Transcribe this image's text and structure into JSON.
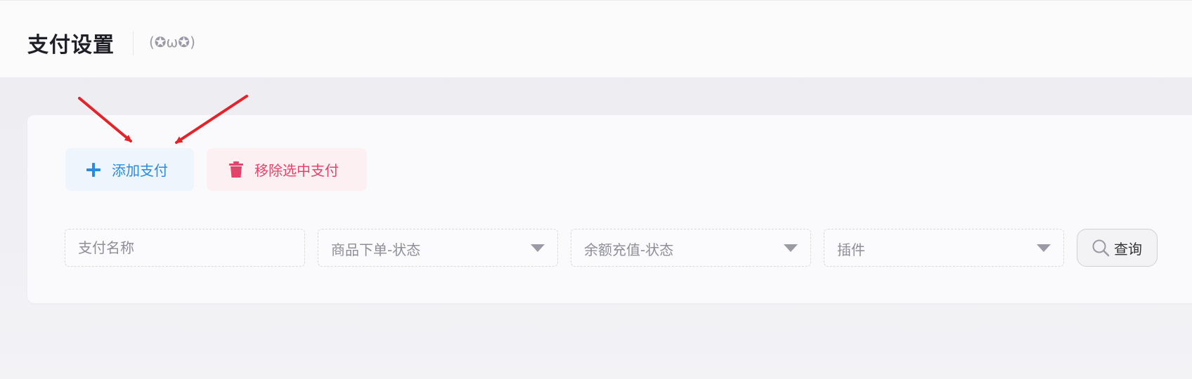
{
  "header": {
    "title": "支付设置",
    "subtitle": "(✪ω✪)"
  },
  "toolbar": {
    "add_label": "添加支付",
    "remove_label": "移除选中支付"
  },
  "filters": {
    "name_placeholder": "支付名称",
    "order_status_label": "商品下单-状态",
    "recharge_status_label": "余额充值-状态",
    "plugin_label": "插件",
    "query_label": "查询"
  },
  "colors": {
    "add_accent": "#2b8be0",
    "remove_accent": "#e0466b",
    "annotation_arrow": "#e4222a"
  },
  "icons": {
    "add": "plus-icon",
    "remove": "trash-icon",
    "query": "search-icon",
    "dropdown": "chevron-down-icon"
  }
}
